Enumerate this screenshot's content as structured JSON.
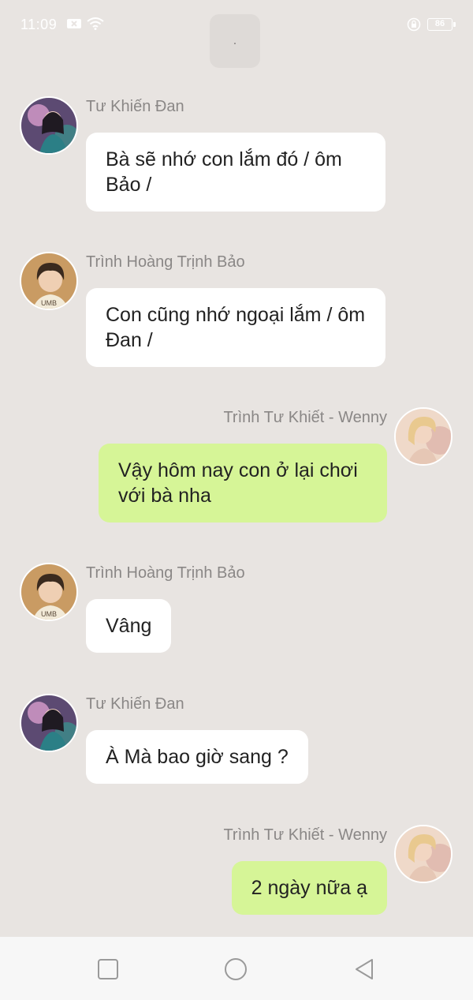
{
  "status_bar": {
    "time": "11:09",
    "battery": "86"
  },
  "top_indicator": ".",
  "messages": [
    {
      "side": "left",
      "sender": "Tư Khiến Đan",
      "text": "Bà sẽ nhớ con lắm đó / ôm Bảo /",
      "avatar": "girl-portrait-avatar"
    },
    {
      "side": "left",
      "sender": "Trình  Hoàng Trịnh Bảo",
      "text": "Con cũng nhớ ngoại lắm / ôm Đan /",
      "avatar": "boy-portrait-avatar"
    },
    {
      "side": "right",
      "sender": "Trình Tư Khiết - Wenny",
      "text": "Vậy hôm nay con ở lại chơi với bà nha",
      "avatar": "blonde-portrait-avatar"
    },
    {
      "side": "left",
      "sender": "Trình  Hoàng Trịnh Bảo",
      "text": "Vâng",
      "avatar": "boy-portrait-avatar"
    },
    {
      "side": "left",
      "sender": "Tư Khiến Đan",
      "text": "À Mà bao giờ sang ?",
      "avatar": "girl-portrait-avatar"
    },
    {
      "side": "right",
      "sender": "Trình Tư Khiết - Wenny",
      "text": "2 ngày nữa ạ",
      "avatar": "blonde-portrait-avatar"
    }
  ],
  "nav_bar": {
    "recent_icon": "square-icon",
    "home_icon": "circle-icon",
    "back_icon": "triangle-back-icon"
  },
  "colors": {
    "background": "#e8e4e1",
    "incoming_bubble": "#ffffff",
    "outgoing_bubble": "#d6f597",
    "sender_name": "#8a8786"
  }
}
